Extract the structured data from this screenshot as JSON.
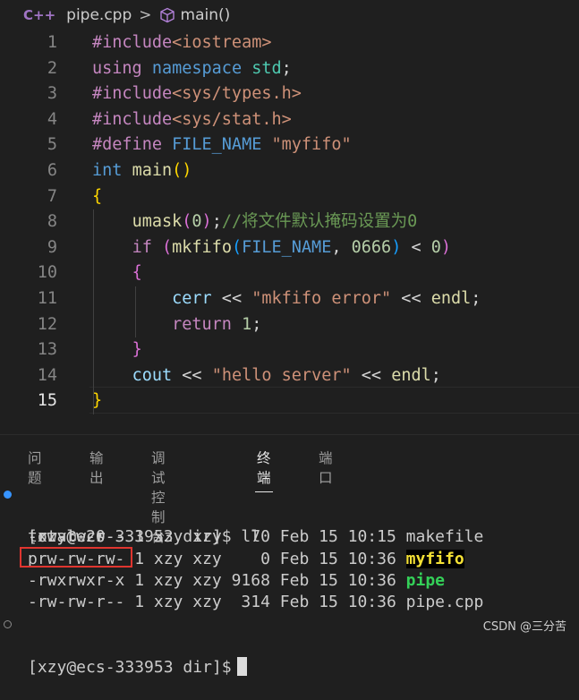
{
  "breadcrumb": {
    "lang_icon": "C++",
    "file": "pipe.cpp",
    "separator": ">",
    "symbol": "main()"
  },
  "editor": {
    "active_line": 15,
    "lines": [
      {
        "n": "1",
        "tokens": [
          [
            "#include",
            "pp"
          ],
          [
            "<iostream>",
            "str"
          ]
        ]
      },
      {
        "n": "2",
        "tokens": [
          [
            "using",
            "pp"
          ],
          [
            " ",
            "pl"
          ],
          [
            "namespace",
            "kw"
          ],
          [
            " ",
            "pl"
          ],
          [
            "std",
            "ty"
          ],
          [
            ";",
            "pl"
          ]
        ]
      },
      {
        "n": "3",
        "tokens": [
          [
            "#include",
            "pp"
          ],
          [
            "<sys/types.h>",
            "str"
          ]
        ]
      },
      {
        "n": "4",
        "tokens": [
          [
            "#include",
            "pp"
          ],
          [
            "<sys/stat.h>",
            "str"
          ]
        ]
      },
      {
        "n": "5",
        "tokens": [
          [
            "#define",
            "pp"
          ],
          [
            " ",
            "pl"
          ],
          [
            "FILE_NAME",
            "kw"
          ],
          [
            " ",
            "pl"
          ],
          [
            "\"myfifo\"",
            "str"
          ]
        ]
      },
      {
        "n": "6",
        "tokens": [
          [
            "int",
            "kw"
          ],
          [
            " ",
            "pl"
          ],
          [
            "main",
            "fn"
          ],
          [
            "()",
            "p1"
          ]
        ]
      },
      {
        "n": "7",
        "tokens": [
          [
            "{",
            "p1"
          ]
        ]
      },
      {
        "n": "8",
        "tokens": [
          [
            "    ",
            "pl"
          ],
          [
            "umask",
            "fn"
          ],
          [
            "(",
            "p2"
          ],
          [
            "0",
            "num"
          ],
          [
            ")",
            "p2"
          ],
          [
            ";",
            "pl"
          ],
          [
            "//将文件默认掩码设置为0",
            "com"
          ]
        ]
      },
      {
        "n": "9",
        "tokens": [
          [
            "    ",
            "pl"
          ],
          [
            "if",
            "pp"
          ],
          [
            " ",
            "pl"
          ],
          [
            "(",
            "p2"
          ],
          [
            "mkfifo",
            "fn"
          ],
          [
            "(",
            "p3"
          ],
          [
            "FILE_NAME",
            "kw"
          ],
          [
            ", ",
            "pl"
          ],
          [
            "0666",
            "num"
          ],
          [
            ")",
            "p3"
          ],
          [
            " < ",
            "pl"
          ],
          [
            "0",
            "num"
          ],
          [
            ")",
            "p2"
          ]
        ]
      },
      {
        "n": "10",
        "tokens": [
          [
            "    ",
            "pl"
          ],
          [
            "{",
            "p2"
          ]
        ]
      },
      {
        "n": "11",
        "tokens": [
          [
            "        ",
            "pl"
          ],
          [
            "cerr",
            "id"
          ],
          [
            " << ",
            "pl"
          ],
          [
            "\"mkfifo error\"",
            "str"
          ],
          [
            " << ",
            "pl"
          ],
          [
            "endl",
            "fn"
          ],
          [
            ";",
            "pl"
          ]
        ]
      },
      {
        "n": "12",
        "tokens": [
          [
            "        ",
            "pl"
          ],
          [
            "return",
            "pp"
          ],
          [
            " ",
            "pl"
          ],
          [
            "1",
            "num"
          ],
          [
            ";",
            "pl"
          ]
        ]
      },
      {
        "n": "13",
        "tokens": [
          [
            "    ",
            "pl"
          ],
          [
            "}",
            "p2"
          ]
        ]
      },
      {
        "n": "14",
        "tokens": [
          [
            "    ",
            "pl"
          ],
          [
            "cout",
            "id"
          ],
          [
            " << ",
            "pl"
          ],
          [
            "\"hello server\"",
            "str"
          ],
          [
            " << ",
            "pl"
          ],
          [
            "endl",
            "fn"
          ],
          [
            ";",
            "pl"
          ]
        ]
      },
      {
        "n": "15",
        "tokens": [
          [
            "}",
            "p1"
          ]
        ]
      }
    ]
  },
  "panel": {
    "tabs": [
      {
        "label": "问题",
        "active": false
      },
      {
        "label": "输出",
        "active": false
      },
      {
        "label": "调试控制台",
        "active": false
      },
      {
        "label": "终端",
        "active": true
      },
      {
        "label": "端口",
        "active": false
      }
    ]
  },
  "terminal": {
    "prompt_cmd": "[xzy@ecs-333953 dir]$ ll",
    "total": "total 20",
    "files": [
      {
        "perm": "-rw-rw-r--",
        "rest": " 1 xzy xzy   70 Feb 15 10:15 ",
        "name": "makefile",
        "style": "plain"
      },
      {
        "perm": "prw-rw-rw-",
        "rest": " 1 xzy xzy    0 Feb 15 10:36 ",
        "name": "myfifo",
        "style": "fifo"
      },
      {
        "perm": "-rwxrwxr-x",
        "rest": " 1 xzy xzy 9168 Feb 15 10:36 ",
        "name": "pipe",
        "style": "exec"
      },
      {
        "perm": "-rw-rw-r--",
        "rest": " 1 xzy xzy  314 Feb 15 10:36 ",
        "name": "pipe.cpp",
        "style": "plain"
      }
    ],
    "prompt_end": "[xzy@ecs-333953 dir]$"
  },
  "watermark": "CSDN @三分苦",
  "colors": {
    "background": "#1f1f1f",
    "highlight_box": "#e0352f",
    "fifo_name": "#f5e135",
    "exec_name": "#34d058"
  }
}
